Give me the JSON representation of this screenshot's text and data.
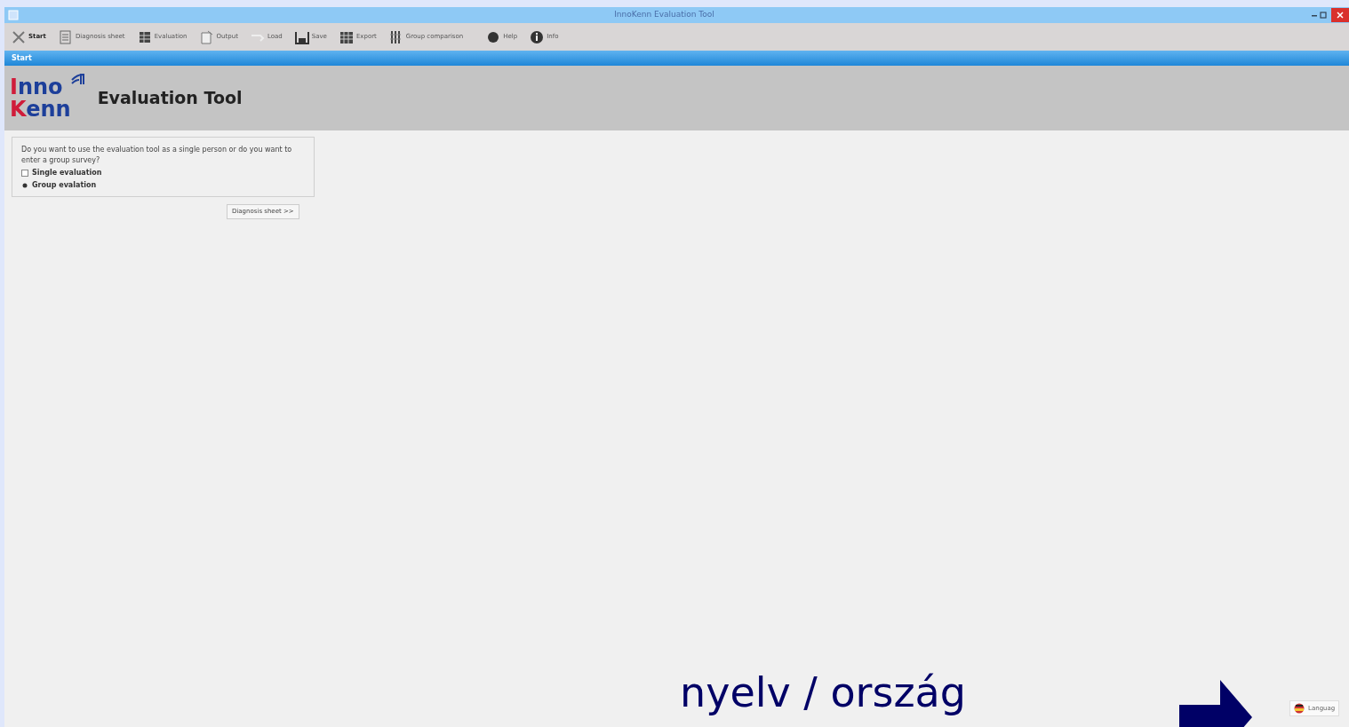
{
  "window": {
    "title": "InnoKenn Evaluation Tool"
  },
  "toolbar": [
    {
      "label": "Start",
      "kind": "start",
      "selected": true
    },
    {
      "label": "Diagnosis sheet",
      "kind": "sheet",
      "selected": false
    },
    {
      "label": "Evaluation",
      "kind": "evaluation",
      "selected": false
    },
    {
      "label": "Output",
      "kind": "output",
      "selected": false
    },
    {
      "label": "Load",
      "kind": "load",
      "selected": false
    },
    {
      "label": "Save",
      "kind": "save",
      "selected": false
    },
    {
      "label": "Export",
      "kind": "export",
      "selected": false
    },
    {
      "label": "Group comparison",
      "kind": "group",
      "selected": false
    },
    {
      "label": "Help",
      "kind": "help",
      "selected": false
    },
    {
      "label": "Info",
      "kind": "info",
      "selected": false
    }
  ],
  "tab": {
    "label": "Start"
  },
  "header": {
    "logo": [
      "Inno",
      "Kenn"
    ],
    "title": "Evaluation Tool"
  },
  "question": {
    "text": "Do you want to use the evaluation tool as a single person or do you want to enter a group survey?",
    "options": [
      {
        "label": "Single evaluation",
        "selected": false
      },
      {
        "label": "Group evalation",
        "selected": true
      }
    ]
  },
  "next_button": {
    "label": "Diagnosis sheet >>"
  },
  "language_button": {
    "label": "Languag"
  },
  "annotation": {
    "text": "nyelv / ország"
  }
}
